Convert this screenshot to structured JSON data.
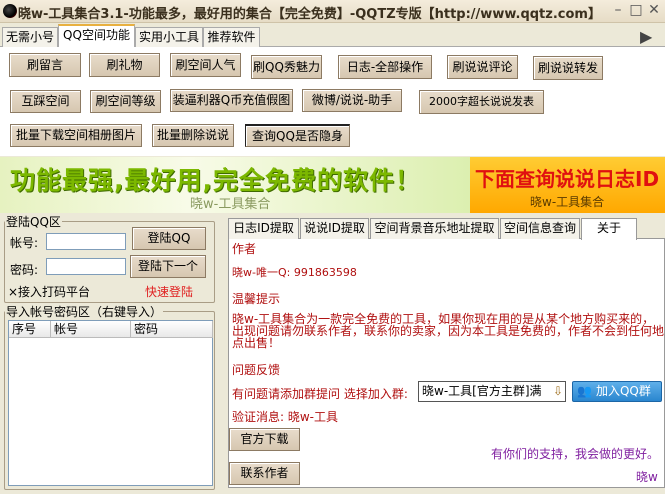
{
  "window": {
    "title": "晓w-工具集合3.1-功能最多，最好用的集合【完全免费】-QQTZ专版【http://www.qqtz.com】",
    "minimize": "–",
    "maximize": "□",
    "close": "✕"
  },
  "tabs": [
    "无需小号",
    "QQ空间功能",
    "实用小工具",
    "推荐软件"
  ],
  "tab_scroll": "▶",
  "buttons": {
    "row1": [
      "刷留言",
      "刷礼物",
      "刷空间人气",
      "刷QQ秀魅力",
      "日志-全部操作",
      "刷说说评论",
      "刷说说转发"
    ],
    "row2": [
      "互踩空间",
      "刷空间等级",
      "装逼利器Q币充值假图",
      "微博/说说-助手",
      "2000字超长说说发表"
    ],
    "row3": [
      "批量下载空间相册图片",
      "批量删除说说",
      "查询QQ是否隐身"
    ]
  },
  "banner": {
    "main": "功能最强,最好用,完全免费的软件！",
    "sub": "晓w-工具集合",
    "right_main": "下面查询说说日志ID",
    "right_sub": "晓w-工具集合"
  },
  "login": {
    "group": "登陆QQ区",
    "account_label": "帐号:",
    "account_value": "",
    "password_label": "密码:",
    "password_value": "",
    "login_btn": "登陆QQ",
    "next_btn": "登陆下一个",
    "captcha": "×接入打码平台",
    "quick_login": "快速登陆"
  },
  "import": {
    "group": "导入帐号密码区（右键导入）",
    "columns": [
      "序号",
      "帐号",
      "密码"
    ]
  },
  "right_tabs": [
    "日志ID提取",
    "说说ID提取",
    "空间背景音乐地址提取",
    "空间信息查询",
    "关于"
  ],
  "about": {
    "author_h": "作者",
    "author": "晓w-唯一Q: 991863598",
    "tips_h": "温馨提示",
    "tips": "晓w-工具集合为一款完全免费的工具，如果你现在用的是从某个地方购买来的，出现问题请勿联系作者，联系你的卖家，因为本工具是免费的，作者不会到任何地点出售！",
    "feedback_h": "问题反馈",
    "feedback": "有问题请添加群提问 选择加入群:",
    "group_select": "晓w-工具[官方主群]满",
    "join_btn": "加入QQ群",
    "verify": "验证消息: 晓w-工具",
    "download_btn": "官方下载",
    "contact_btn": "联系作者",
    "thanks": "有你们的支持，我会做的更好。",
    "sign": "晓w"
  }
}
